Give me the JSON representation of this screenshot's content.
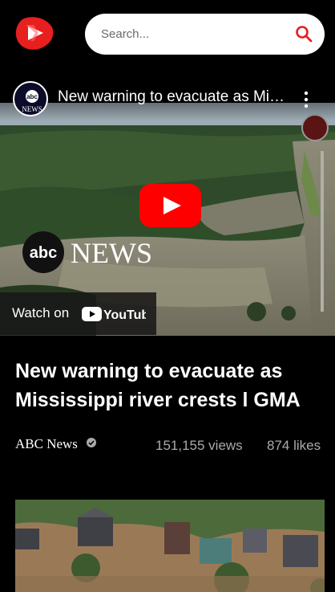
{
  "search": {
    "placeholder": "Search..."
  },
  "player": {
    "title": "New warning to evacuate as Mississippi river crests | GMA",
    "channel_logo_text": "abc NEWS",
    "watch_on_label": "Watch on",
    "youtube_wordmark": "YouTube",
    "watermark": "abc NEWS"
  },
  "video": {
    "title": "New warning to evacuate as Mississippi river crests l GMA",
    "channel": "ABC News",
    "views": "151,155 views",
    "likes": "874 likes"
  },
  "colors": {
    "brand_red": "#e81f1f",
    "youtube_red": "#ff0000",
    "background": "#000000",
    "meta_gray": "#aaaaaa"
  },
  "icons": {
    "logo": "play-logo-icon",
    "search": "search-icon",
    "more": "more-vertical-icon",
    "play": "play-icon",
    "verified": "verified-icon"
  }
}
